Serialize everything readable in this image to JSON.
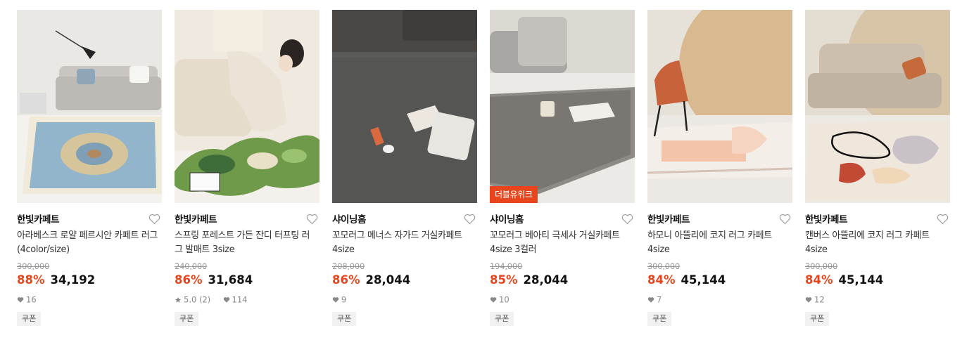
{
  "colors": {
    "discount": "#e8451d",
    "badge_bg": "#e8451d"
  },
  "products": [
    {
      "brand": "한빛카페트",
      "title": "아라베스크 로얄 페르시안 카페트 러그 (4color/size)",
      "original_price": "300,000",
      "discount": "88%",
      "price": "34,192",
      "rating": "",
      "likes": "16",
      "coupon": "쿠폰",
      "badge": ""
    },
    {
      "brand": "한빛카페트",
      "title": "스프링 포레스트 가든 잔디 터프팅 러그 발매트 3size",
      "original_price": "240,000",
      "discount": "86%",
      "price": "31,684",
      "rating": "5.0 (2)",
      "likes": "114",
      "coupon": "쿠폰",
      "badge": ""
    },
    {
      "brand": "샤이닝홈",
      "title": "꼬모러그 메너스 자가드 거실카페트 4size",
      "original_price": "208,000",
      "discount": "86%",
      "price": "28,044",
      "rating": "",
      "likes": "9",
      "coupon": "쿠폰",
      "badge": ""
    },
    {
      "brand": "샤이닝홈",
      "title": "꼬모러그 베아티 극세사 거실카페트 4size 3컬러",
      "original_price": "194,000",
      "discount": "85%",
      "price": "28,044",
      "rating": "",
      "likes": "10",
      "coupon": "쿠폰",
      "badge": "더블유위크"
    },
    {
      "brand": "한빛카페트",
      "title": "하모니 아뜰리에 코지 러그 카페트 4size",
      "original_price": "300,000",
      "discount": "84%",
      "price": "45,144",
      "rating": "",
      "likes": "7",
      "coupon": "쿠폰",
      "badge": ""
    },
    {
      "brand": "한빛카페트",
      "title": "캔버스 아뜰리에 코지 러그 카페트 4size",
      "original_price": "300,000",
      "discount": "84%",
      "price": "45,144",
      "rating": "",
      "likes": "12",
      "coupon": "쿠폰",
      "badge": ""
    }
  ]
}
